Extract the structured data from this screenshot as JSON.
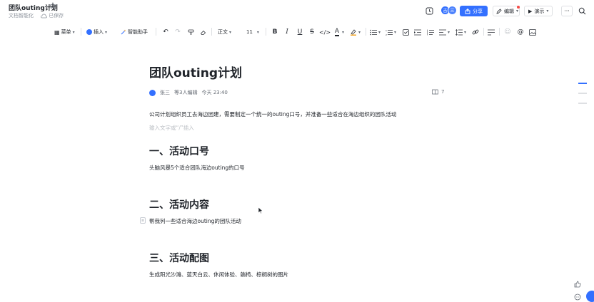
{
  "header": {
    "title": "团队outing计划",
    "subtitle_left": "文档智能化",
    "saved": "已保存",
    "share_label": "分享",
    "edit_label": "编辑",
    "present_label": "演示",
    "more_label": "···",
    "avatar_1": "吉",
    "avatar_2": "三"
  },
  "toolbar": {
    "menu_label": "菜单",
    "insert_label": "插入",
    "ai_label": "智能助手",
    "style_label": "正文",
    "font_size": "11"
  },
  "document": {
    "title": "团队outing计划",
    "author": "张三",
    "editors": "等3人编辑",
    "time": "今天 23:40",
    "read_count": "7",
    "intro": "公司计划组织员工去海边团建，需要制定一个统一的outing口号，并准备一些适合在海边组织的团队活动",
    "placeholder": "输入文字或“/”插入",
    "sections": [
      {
        "heading": "一、活动口号",
        "body": "头脑风暴5个适合团队海边outing的口号"
      },
      {
        "heading": "二、活动内容",
        "body": "帮我列一些适合海边outing的团队活动"
      },
      {
        "heading": "三、活动配图",
        "body": "生成阳光沙滩、蓝天白云、休闲体验、躺椅、棕榈树的图片"
      }
    ]
  },
  "colors": {
    "accent": "#3370ff",
    "text": "#1f2329",
    "muted": "#8f959e"
  }
}
